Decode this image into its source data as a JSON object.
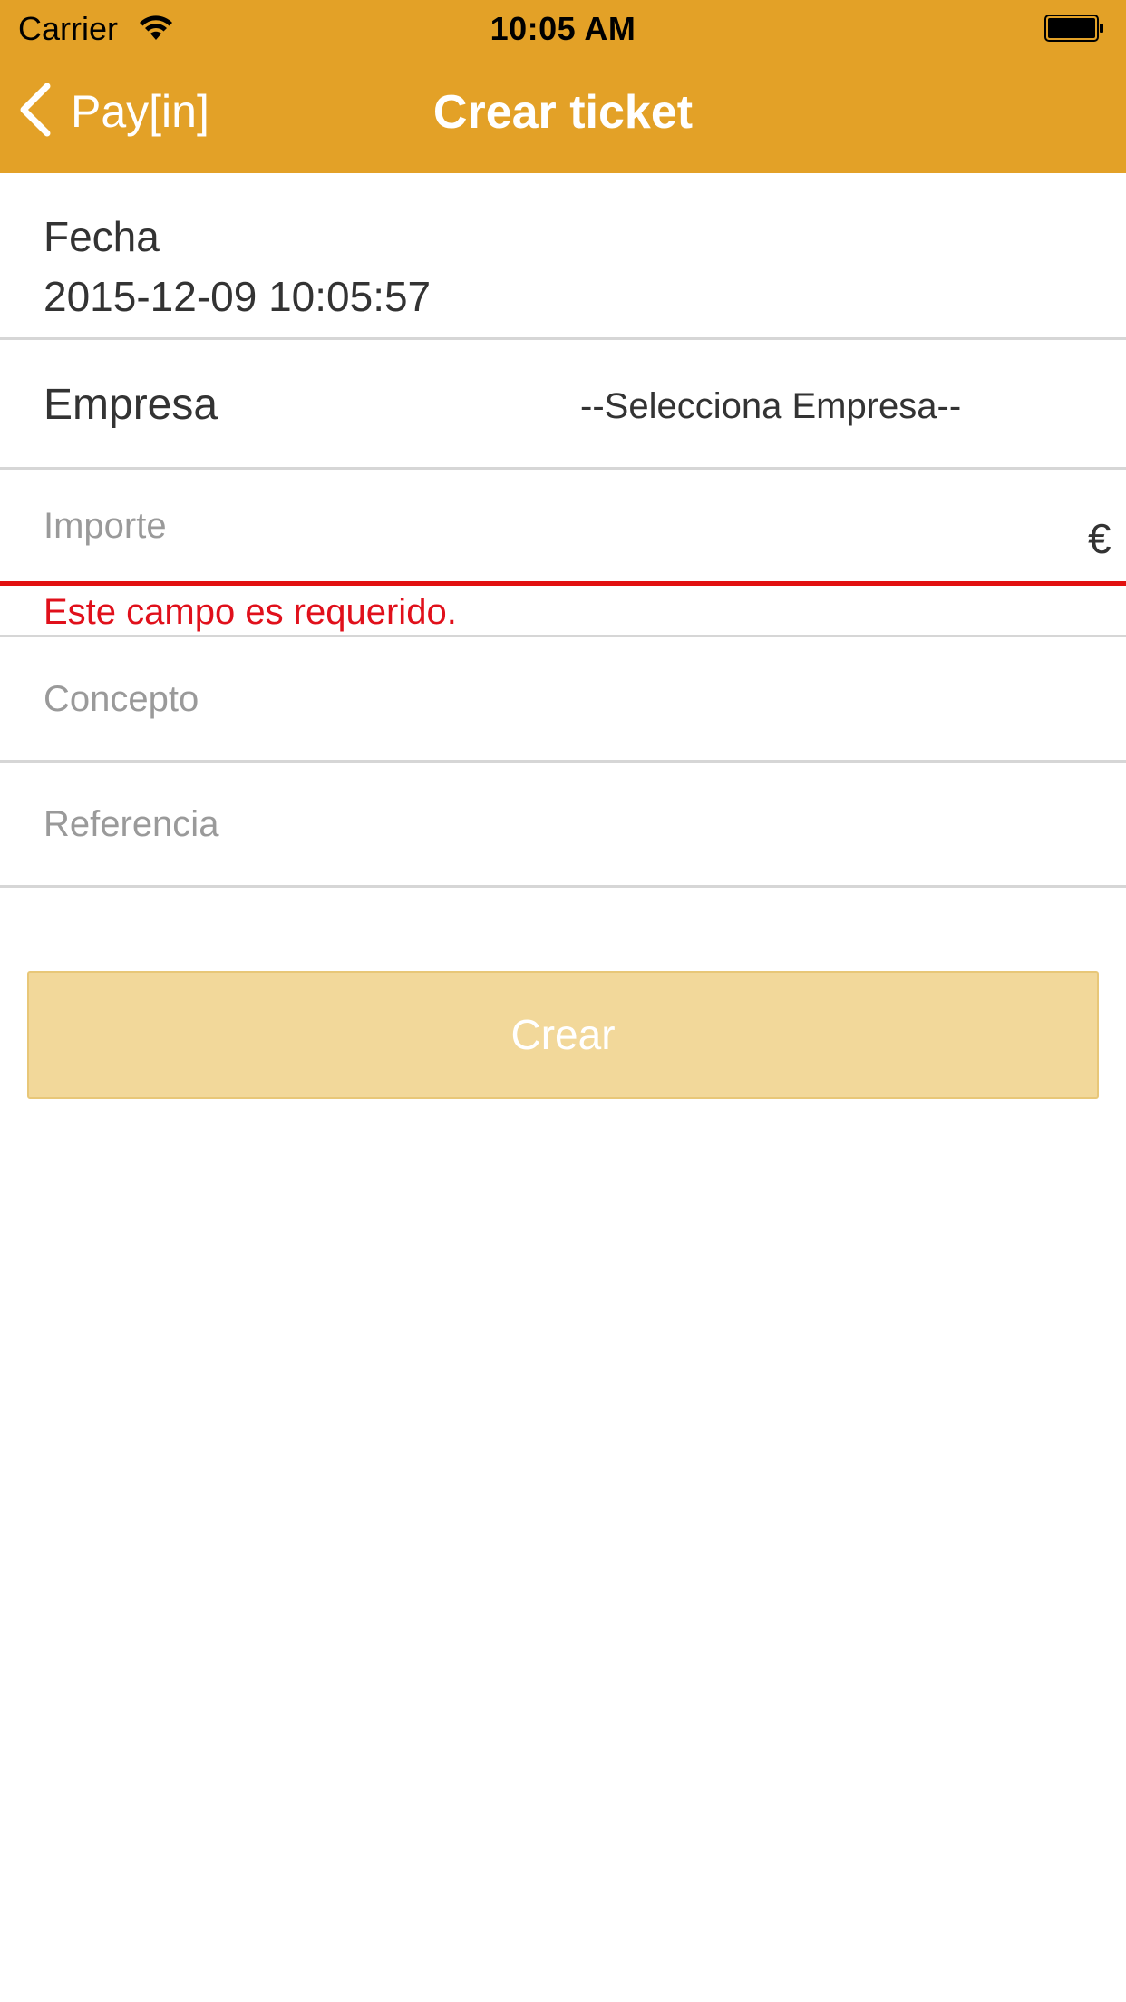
{
  "status_bar": {
    "carrier": "Carrier",
    "time": "10:05 AM",
    "wifi_icon": "wifi-icon",
    "battery_icon": "battery-icon"
  },
  "nav": {
    "back_label": "Pay[in]",
    "back_icon": "chevron-left-icon",
    "title": "Crear ticket"
  },
  "form": {
    "fecha": {
      "label": "Fecha",
      "value": "2015-12-09 10:05:57"
    },
    "empresa": {
      "label": "Empresa",
      "selected": "--Selecciona Empresa--"
    },
    "importe": {
      "placeholder": "Importe",
      "currency": "€",
      "error": "Este campo es requerido."
    },
    "concepto": {
      "placeholder": "Concepto"
    },
    "referencia": {
      "placeholder": "Referencia"
    },
    "submit_label": "Crear"
  },
  "colors": {
    "header": "#E3A127",
    "button_disabled": "#F2D89A",
    "error": "#E0101B"
  }
}
